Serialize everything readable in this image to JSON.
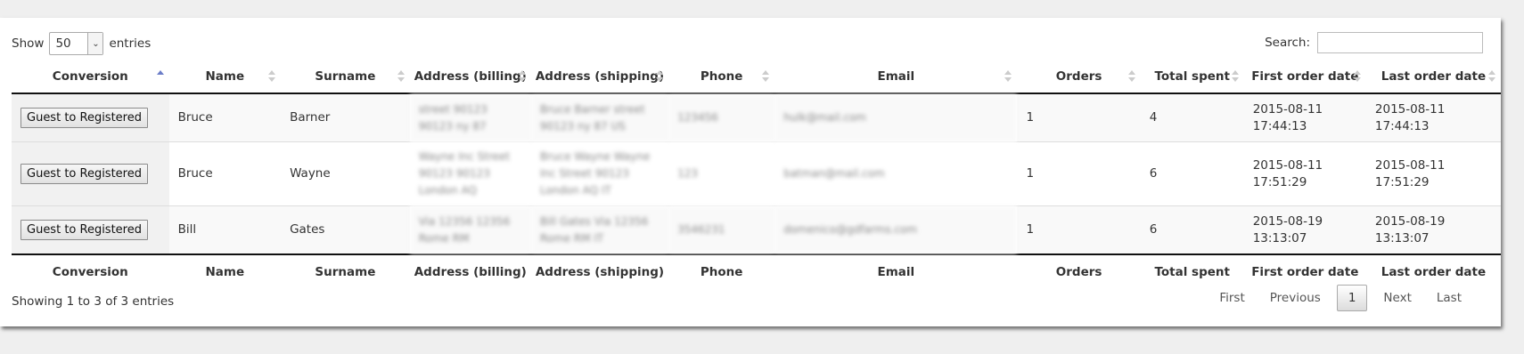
{
  "length_menu": {
    "prefix": "Show",
    "value": "50",
    "suffix": "entries"
  },
  "search": {
    "label": "Search:",
    "value": ""
  },
  "columns": [
    "Conversion",
    "Name",
    "Surname",
    "Address (billing)",
    "Address (shipping)",
    "Phone",
    "Email",
    "Orders",
    "Total spent",
    "First order date",
    "Last order date"
  ],
  "rows": [
    {
      "action": "Guest to Registered",
      "name": "Bruce",
      "surname": "Barner",
      "billing": "street 90123 90123 ny 87",
      "shipping": "Bruce Barner street 90123 ny 87 US",
      "phone": "123456",
      "email": "hulk@mail.com",
      "orders": "1",
      "total": "4",
      "first_date": "2015-08-11",
      "first_time": "17:44:13",
      "last_date": "2015-08-11",
      "last_time": "17:44:13"
    },
    {
      "action": "Guest to Registered",
      "name": "Bruce",
      "surname": "Wayne",
      "billing": "Wayne Inc Street 90123 90123 London AQ",
      "shipping": "Bruce Wayne Wayne Inc Street 90123 London AQ IT",
      "phone": "123",
      "email": "batman@mail.com",
      "orders": "1",
      "total": "6",
      "first_date": "2015-08-11",
      "first_time": "17:51:29",
      "last_date": "2015-08-11",
      "last_time": "17:51:29"
    },
    {
      "action": "Guest to Registered",
      "name": "Bill",
      "surname": "Gates",
      "billing": "Via 12356 12356 Rome RM",
      "shipping": "Bill Gates Via 12356 Rome RM IT",
      "phone": "3546231",
      "email": "domenico@gdfarms.com",
      "orders": "1",
      "total": "6",
      "first_date": "2015-08-19",
      "first_time": "13:13:07",
      "last_date": "2015-08-19",
      "last_time": "13:13:07"
    }
  ],
  "info": "Showing 1 to 3 of 3 entries",
  "pagination": {
    "first": "First",
    "previous": "Previous",
    "current": "1",
    "next": "Next",
    "last": "Last"
  },
  "colors": {
    "sort_active": "#6b7dc8",
    "sort_inactive": "#cccccc"
  }
}
